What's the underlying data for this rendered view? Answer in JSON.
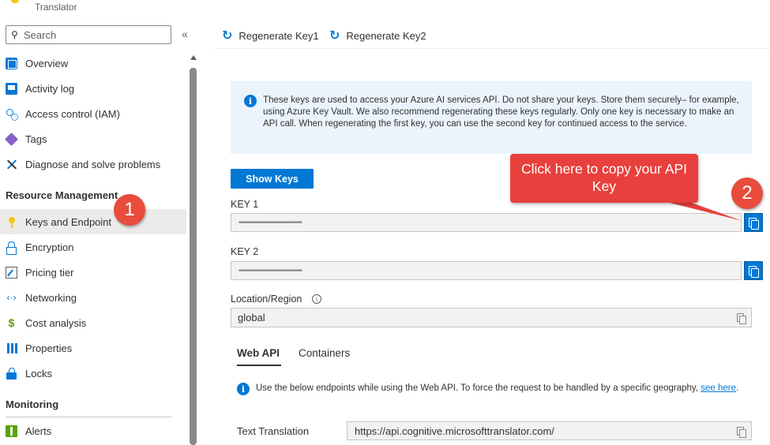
{
  "app": {
    "subtitle": "Translator"
  },
  "sidebar": {
    "search_placeholder": "Search",
    "collapse_glyph": "«",
    "items_top": [
      {
        "label": "Overview",
        "icon": "overview-icon"
      },
      {
        "label": "Activity log",
        "icon": "activity-log-icon"
      },
      {
        "label": "Access control (IAM)",
        "icon": "access-control-icon"
      },
      {
        "label": "Tags",
        "icon": "tag-icon"
      },
      {
        "label": "Diagnose and solve problems",
        "icon": "wrench-icon"
      }
    ],
    "section_resource": "Resource Management",
    "items_resource": [
      {
        "label": "Keys and Endpoint",
        "icon": "key-icon",
        "active": true
      },
      {
        "label": "Encryption",
        "icon": "lock-icon"
      },
      {
        "label": "Pricing tier",
        "icon": "pricing-icon"
      },
      {
        "label": "Networking",
        "icon": "networking-icon"
      },
      {
        "label": "Cost analysis",
        "icon": "cost-icon"
      },
      {
        "label": "Properties",
        "icon": "properties-icon"
      },
      {
        "label": "Locks",
        "icon": "locks-icon"
      }
    ],
    "section_monitoring": "Monitoring",
    "items_monitoring": [
      {
        "label": "Alerts",
        "icon": "alerts-icon"
      }
    ]
  },
  "annotations": {
    "step1": "1",
    "step2": "2",
    "callout": "Click here to copy your API Key",
    "colors": {
      "badge": "#e74c3c",
      "callout": "#e8403c"
    }
  },
  "toolbar": {
    "regen1": "Regenerate Key1",
    "regen2": "Regenerate Key2"
  },
  "info": {
    "text": "These keys are used to access your Azure AI services API. Do not share your keys. Store them securely– for example, using Azure Key Vault. We also recommend regenerating these keys regularly. Only one key is necessary to make an API call. When regenerating the first key, you can use the second key for continued access to the service."
  },
  "keys": {
    "show_keys": "Show Keys",
    "key1_label": "KEY 1",
    "key1_value": "••••••••••••••••••••••••••••••••",
    "key2_label": "KEY 2",
    "key2_value": "••••••••••••••••••••••••••••••••"
  },
  "location": {
    "label": "Location/Region",
    "value": "global"
  },
  "tabs": {
    "web_api": "Web API",
    "containers": "Containers"
  },
  "web_api": {
    "info_text": "Use the below endpoints while using the Web API. To force the request to be handled by a specific geography,",
    "link_text": "see here",
    "trailing": ".",
    "text_translation_label": "Text Translation",
    "text_translation_url": "https://api.cognitive.microsofttranslator.com/"
  },
  "theme": {
    "accent": "#0078d4",
    "active_bg": "#edebe9"
  }
}
